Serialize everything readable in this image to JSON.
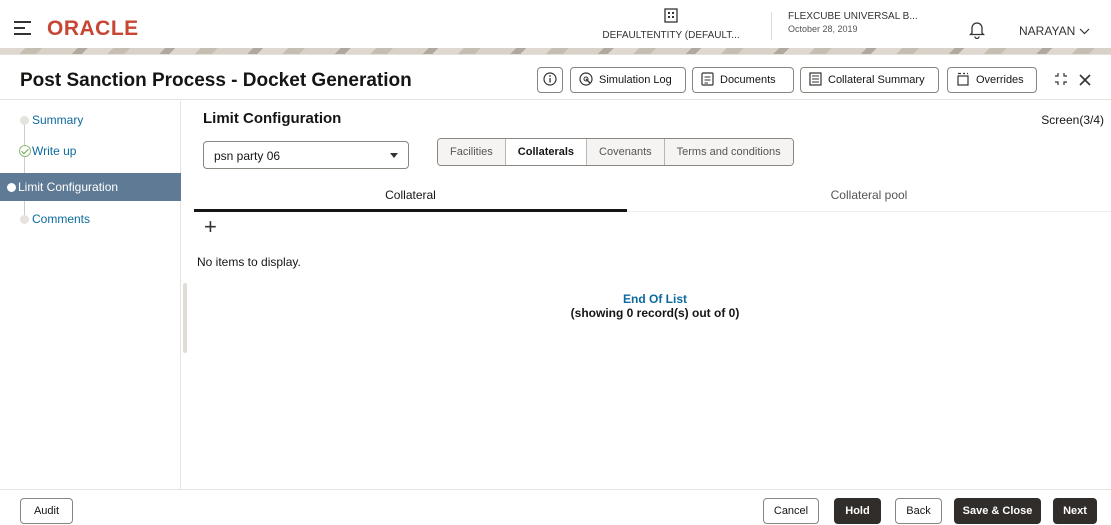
{
  "header": {
    "logo": "ORACLE",
    "entity": "DEFAULTENTITY (DEFAULT...",
    "branch": "FLEXCUBE UNIVERSAL B...",
    "date": "October 28, 2019",
    "user": "NARAYAN",
    "brand_color": "#c74634"
  },
  "titlebar": {
    "title": "Post Sanction Process - Docket Generation",
    "buttons": {
      "simulation_log": "Simulation Log",
      "documents": "Documents",
      "collateral_summary": "Collateral Summary",
      "overrides": "Overrides"
    }
  },
  "sidebar": {
    "items": [
      {
        "label": "Summary",
        "state": "pending"
      },
      {
        "label": "Write up",
        "state": "done"
      },
      {
        "label": "Limit Configuration",
        "state": "active"
      },
      {
        "label": "Comments",
        "state": "pending"
      }
    ]
  },
  "main": {
    "section_title": "Limit Configuration",
    "screen_indicator": "Screen(3/4)",
    "party_select_value": "psn party 06",
    "segments": [
      "Facilities",
      "Collaterals",
      "Covenants",
      "Terms and conditions"
    ],
    "selected_segment": "Collaterals",
    "tabs": [
      "Collateral",
      "Collateral pool"
    ],
    "selected_tab": "Collateral",
    "add_symbol": "+",
    "empty_message": "No items to display.",
    "end_of_list": "End Of List",
    "record_count": "(showing 0 record(s) out of 0)"
  },
  "footer": {
    "audit": "Audit",
    "cancel": "Cancel",
    "hold": "Hold",
    "back": "Back",
    "save_close": "Save & Close",
    "next": "Next"
  }
}
